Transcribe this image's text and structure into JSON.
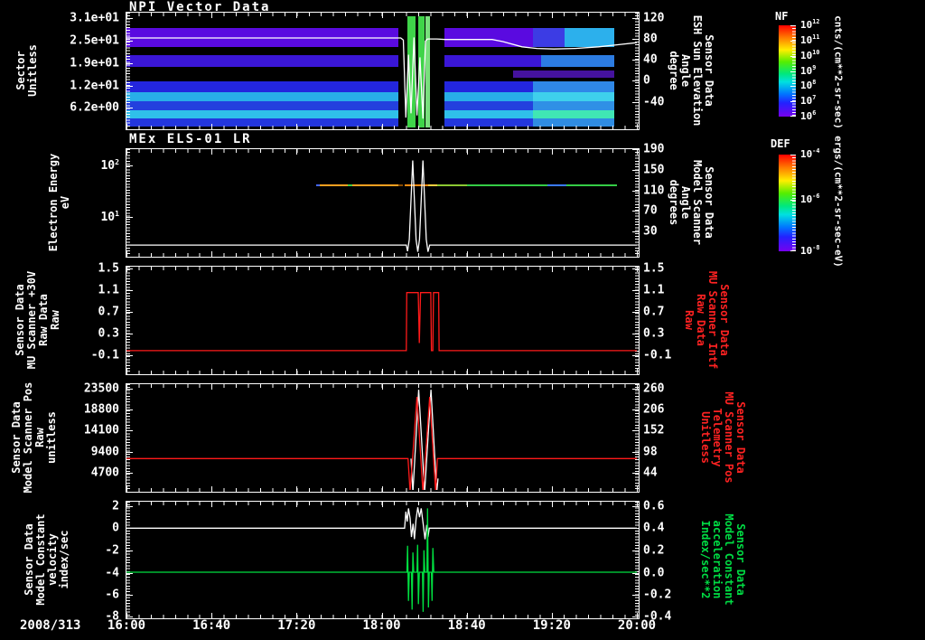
{
  "x_axis": {
    "date_label": "2008/313",
    "tick_labels": [
      "16:00",
      "16:40",
      "17:20",
      "18:00",
      "18:40",
      "19:20",
      "20:00"
    ],
    "range_minutes": [
      0,
      240
    ]
  },
  "colorbars": [
    {
      "title": "NF",
      "unit": "cnts/(cm**2-sr-sec)",
      "tick_labels": [
        "10^12",
        "10^11",
        "10^10",
        "10^9",
        "10^8",
        "10^7",
        "10^6"
      ],
      "tick_fracs": [
        0,
        0.1667,
        0.3333,
        0.5,
        0.6667,
        0.8333,
        1
      ]
    },
    {
      "title": "DEF",
      "unit": "ergs/(cm**2-sr-sec-eV)",
      "tick_labels": [
        "10^-4",
        "10^-6",
        "10^-8"
      ],
      "tick_fracs": [
        0,
        0.47,
        1
      ]
    }
  ],
  "chart_data": [
    {
      "id": "npi-vector-data",
      "type": "heatmap",
      "title": "NPI Vector Data",
      "left_label_lines": [
        "Sector",
        "Unitless"
      ],
      "left_ticks": [
        [
          "3.1e+01",
          0.05
        ],
        [
          "2.5e+01",
          0.245
        ],
        [
          "1.9e+01",
          0.44
        ],
        [
          "1.2e+01",
          0.635
        ],
        [
          "6.2e+00",
          0.83
        ]
      ],
      "right_ticks": [
        [
          "120",
          0.047
        ],
        [
          "80",
          0.228
        ],
        [
          "40",
          0.41
        ],
        [
          "0",
          0.594
        ],
        [
          "-40",
          0.777
        ]
      ],
      "right_label_lines": [
        "Sensor Data",
        "ESH Sun Elevation",
        "Angle",
        "degree"
      ],
      "right_label_color": "#ffffff",
      "ymap": [
        120,
        0.047,
        -40,
        0.777
      ],
      "rects": [
        [
          0,
          130,
          0.135,
          0.3,
          "#5a0ae0"
        ],
        [
          149.5,
          191,
          0.135,
          0.3,
          "#5a0ae0"
        ],
        [
          191,
          206,
          0.135,
          0.3,
          "#3c3ce4"
        ],
        [
          206,
          229.5,
          0.135,
          0.3,
          "#2cb0ec"
        ],
        [
          0,
          130,
          0.37,
          0.475,
          "#3a16d6"
        ],
        [
          149.5,
          195,
          0.37,
          0.475,
          "#3a16d6"
        ],
        [
          195,
          229.5,
          0.37,
          0.475,
          "#2c7ce2"
        ],
        [
          182,
          229.5,
          0.5,
          0.565,
          "#45129e"
        ],
        [
          0,
          130,
          0.6,
          0.695,
          "#2326de"
        ],
        [
          149.5,
          191,
          0.6,
          0.695,
          "#2326de"
        ],
        [
          191,
          229.5,
          0.6,
          0.695,
          "#2f88e8"
        ],
        [
          0,
          130,
          0.695,
          0.775,
          "#28aee8"
        ],
        [
          149.5,
          191,
          0.695,
          0.775,
          "#28aee8"
        ],
        [
          191,
          229.5,
          0.695,
          0.775,
          "#3ed0ec"
        ],
        [
          0,
          130,
          0.775,
          0.85,
          "#2340de"
        ],
        [
          149.5,
          191,
          0.775,
          0.85,
          "#2340de"
        ],
        [
          191,
          229.5,
          0.775,
          0.85,
          "#2f90e6"
        ],
        [
          0,
          130,
          0.85,
          0.925,
          "#2fc0ea"
        ],
        [
          149.5,
          191,
          0.85,
          0.925,
          "#2fc0ea"
        ],
        [
          191,
          229.5,
          0.85,
          0.925,
          "#40e6b4"
        ],
        [
          0,
          130,
          0.925,
          0.99,
          "#2336de"
        ],
        [
          149.5,
          191,
          0.925,
          0.99,
          "#2336de"
        ],
        [
          191,
          229.5,
          0.925,
          0.99,
          "#2f8ce2"
        ],
        [
          128,
          149.5,
          0,
          1,
          "#000000"
        ],
        [
          132.3,
          135.8,
          0.03,
          1,
          "#3fd449"
        ],
        [
          137,
          140,
          0.03,
          1,
          "#3fd449"
        ],
        [
          140.6,
          142.8,
          0.03,
          1,
          "#79e07d"
        ]
      ],
      "series": [
        {
          "name": "esh-sun-elevation-angle",
          "color": "#ffffff",
          "points": [
            [
              0,
              82
            ],
            [
              129,
              82
            ],
            [
              130.2,
              78
            ],
            [
              131.4,
              -70
            ],
            [
              132.6,
              50
            ],
            [
              133.8,
              -62
            ],
            [
              135.2,
              83
            ],
            [
              136.6,
              -66
            ],
            [
              138,
              45
            ],
            [
              139.4,
              -72
            ],
            [
              140.6,
              76
            ],
            [
              141.6,
              80
            ],
            [
              146,
              80
            ],
            [
              150,
              79
            ],
            [
              172,
              79
            ],
            [
              177,
              75
            ],
            [
              186,
              65
            ],
            [
              193,
              62
            ],
            [
              201,
              61
            ],
            [
              211,
              62
            ],
            [
              222,
              65
            ],
            [
              231,
              69
            ],
            [
              240,
              73
            ]
          ]
        }
      ]
    },
    {
      "id": "mex-els-01-lr",
      "type": "heatmap",
      "title": "MEx ELS-01 LR",
      "left_label_lines": [
        "Electron Energy",
        "eV"
      ],
      "left_ticks": [
        [
          "10^2",
          0.154
        ],
        [
          "10^1",
          0.641
        ]
      ],
      "right_ticks": [
        [
          "190",
          0.0
        ],
        [
          "150",
          0.195
        ],
        [
          "110",
          0.39
        ],
        [
          "70",
          0.585
        ],
        [
          "30",
          0.78
        ]
      ],
      "right_label_lines": [
        "Sensor Data",
        "Model Scanner",
        "Angle",
        "degrees"
      ],
      "right_label_color": "#ffffff",
      "ymap": [
        150,
        0.195,
        30,
        0.78
      ],
      "energy_line": {
        "y_frac": 0.342,
        "segments": [
          [
            89,
            91,
            "#4466ff"
          ],
          [
            91,
            104,
            "#ffa020"
          ],
          [
            104,
            106,
            "#44cc44"
          ],
          [
            106,
            128,
            "#ffa020"
          ],
          [
            128,
            130,
            "#8a4a00"
          ],
          [
            131,
            142,
            "#ff8c10"
          ],
          [
            142,
            146,
            "#ffd040"
          ],
          [
            146,
            160,
            "#8cc832"
          ],
          [
            160,
            198,
            "#35cc46"
          ],
          [
            198,
            207,
            "#3a7aff"
          ],
          [
            207,
            230.5,
            "#35cc46"
          ]
        ]
      },
      "series": [
        {
          "name": "model-scanner-angle",
          "color": "#ffffff",
          "points": [
            [
              0,
              4
            ],
            [
              131.6,
              4
            ],
            [
              132.2,
              -8
            ],
            [
              133,
              15
            ],
            [
              134.6,
              168
            ],
            [
              136.2,
              15
            ],
            [
              137,
              -9
            ],
            [
              137.8,
              15
            ],
            [
              139.4,
              168
            ],
            [
              141,
              15
            ],
            [
              141.8,
              -9
            ],
            [
              142.6,
              4
            ],
            [
              240,
              4
            ]
          ]
        }
      ]
    },
    {
      "id": "mu-scanner-30v",
      "type": "line",
      "title": "",
      "left_label_lines": [
        "Sensor Data",
        "MU Scanner +30V",
        "Raw Data",
        "Raw"
      ],
      "left_ticks": [
        [
          "1.5",
          0.015
        ],
        [
          "1.1",
          0.22
        ],
        [
          "0.7",
          0.425
        ],
        [
          "0.3",
          0.63
        ],
        [
          "-0.1",
          0.835
        ]
      ],
      "right_ticks": [
        [
          "1.5",
          0.015
        ],
        [
          "1.1",
          0.22
        ],
        [
          "0.7",
          0.425
        ],
        [
          "0.3",
          0.63
        ],
        [
          "-0.1",
          0.835
        ]
      ],
      "right_label_lines": [
        "Sensor Data",
        "MU Scanner Intf",
        "Raw Data",
        "Raw"
      ],
      "right_label_color": "#ff2222",
      "ymap": [
        1.5,
        0.015,
        -0.1,
        0.835
      ],
      "series": [
        {
          "name": "mu-scanner-intf-raw",
          "color": "#ff1a1a",
          "points": [
            [
              0,
              -0.02
            ],
            [
              131.6,
              -0.02
            ],
            [
              131.8,
              1.05
            ],
            [
              137.2,
              1.05
            ],
            [
              137.7,
              0.12
            ],
            [
              138.3,
              1.05
            ],
            [
              143.1,
              1.05
            ],
            [
              143.4,
              -0.02
            ],
            [
              144.1,
              -0.02
            ],
            [
              144.4,
              1.05
            ],
            [
              146.8,
              1.05
            ],
            [
              147,
              -0.02
            ],
            [
              240,
              -0.02
            ]
          ]
        }
      ]
    },
    {
      "id": "model-scanner-pos",
      "type": "line",
      "title": "",
      "left_label_lines": [
        "Sensor Data",
        "Model Scanner Pos",
        "Raw",
        "unitless"
      ],
      "left_ticks": [
        [
          "23500",
          0.04
        ],
        [
          "18800",
          0.24
        ],
        [
          "14100",
          0.44
        ],
        [
          "9400",
          0.64
        ],
        [
          "4700",
          0.84
        ]
      ],
      "right_ticks": [
        [
          "260",
          0.04
        ],
        [
          "206",
          0.24
        ],
        [
          "152",
          0.44
        ],
        [
          "98",
          0.64
        ],
        [
          "44",
          0.84
        ]
      ],
      "right_label_lines": [
        "Sensor Data",
        "MU Scanner Pos",
        "Telemetry",
        "Unitless"
      ],
      "right_label_color": "#ff2222",
      "ymap": [
        23500,
        0.04,
        4700,
        0.84
      ],
      "series": [
        {
          "name": "model-scanner-pos-raw",
          "color": "#ffffff",
          "points": [
            [
              133.8,
              7900
            ],
            [
              134.7,
              450
            ],
            [
              137.4,
              23200
            ],
            [
              140.2,
              450
            ],
            [
              143.2,
              23200
            ],
            [
              145.9,
              450
            ],
            [
              146.5,
              3500
            ]
          ]
        },
        {
          "name": "mu-scanner-pos-telemetry",
          "color": "#ff1a1a",
          "points": [
            [
              0,
              7900
            ],
            [
              132.4,
              7900
            ],
            [
              133.4,
              450
            ],
            [
              136.6,
              21600
            ],
            [
              139.4,
              450
            ],
            [
              142.6,
              21600
            ],
            [
              145.4,
              450
            ],
            [
              146.2,
              7900
            ],
            [
              240,
              7900
            ]
          ]
        }
      ]
    },
    {
      "id": "model-constant",
      "type": "line",
      "title": "",
      "left_label_lines": [
        "Sensor Data",
        "Model Constant",
        "velocity",
        "index/sec"
      ],
      "left_ticks": [
        [
          "2",
          0.039
        ],
        [
          "0",
          0.231
        ],
        [
          "-2",
          0.425
        ],
        [
          "-4",
          0.62
        ],
        [
          "-6",
          0.809
        ],
        [
          "-8",
          0.998
        ]
      ],
      "right_ticks": [
        [
          "0.6",
          0.039
        ],
        [
          "0.4",
          0.231
        ],
        [
          "0.2",
          0.425
        ],
        [
          "0.0",
          0.62
        ],
        [
          "-0.2",
          0.809
        ],
        [
          "-0.4",
          0.998
        ]
      ],
      "right_label_lines": [
        "Sensor Data",
        "Model Constant",
        "acceleration",
        "Index/sec**2"
      ],
      "right_label_color": "#00dd44",
      "ymap": [
        2,
        0.039,
        -8,
        0.998
      ],
      "series": [
        {
          "name": "model-constant-velocity",
          "color": "#ffffff",
          "points": [
            [
              0,
              0
            ],
            [
              130.8,
              0
            ],
            [
              131.4,
              1.5
            ],
            [
              132,
              0.6
            ],
            [
              132.6,
              1.8
            ],
            [
              133.4,
              0.9
            ],
            [
              134,
              -0.8
            ],
            [
              134.8,
              0.4
            ],
            [
              135.4,
              -1
            ],
            [
              136.2,
              0.8
            ],
            [
              137,
              1.9
            ],
            [
              137.8,
              1
            ],
            [
              138.6,
              1.8
            ],
            [
              139.6,
              0.3
            ],
            [
              140.4,
              -1
            ],
            [
              141.2,
              0.3
            ],
            [
              141.8,
              -0.8
            ],
            [
              142.4,
              0
            ],
            [
              240,
              0
            ]
          ]
        },
        {
          "name": "model-constant-acceleration",
          "color": "#00e040",
          "points": [
            [
              0,
              -4
            ],
            [
              131.9,
              -4
            ],
            [
              132.2,
              -1.6
            ],
            [
              132.6,
              -6.6
            ],
            [
              133,
              -4
            ],
            [
              134,
              -4
            ],
            [
              134.3,
              -7.4
            ],
            [
              134.7,
              -2.2
            ],
            [
              135.1,
              -4
            ],
            [
              136.6,
              -4
            ],
            [
              136.9,
              -1.5
            ],
            [
              137.3,
              -6.9
            ],
            [
              137.7,
              -4
            ],
            [
              139.2,
              -4
            ],
            [
              139.5,
              -7.6
            ],
            [
              139.9,
              -2
            ],
            [
              140.3,
              -4
            ],
            [
              141.3,
              -4
            ],
            [
              141.6,
              1.8
            ],
            [
              142,
              -7.2
            ],
            [
              142.4,
              -4
            ],
            [
              143.4,
              -4
            ],
            [
              143.7,
              -6.6
            ],
            [
              144.1,
              -1.8
            ],
            [
              144.5,
              -4
            ],
            [
              240,
              -4
            ]
          ]
        }
      ]
    }
  ]
}
